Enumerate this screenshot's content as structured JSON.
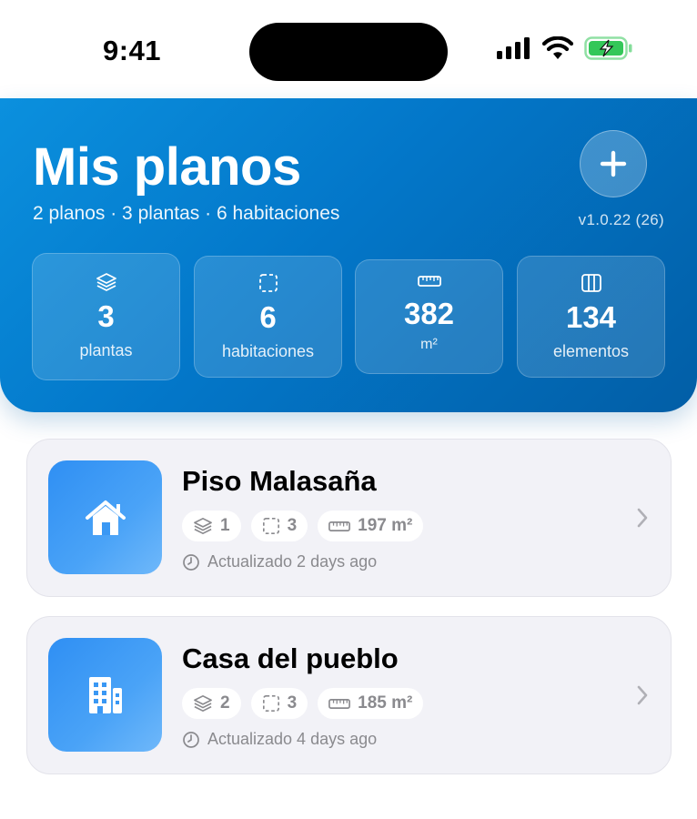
{
  "status_bar": {
    "time": "9:41"
  },
  "header": {
    "title": "Mis planos",
    "subtitle": "2 planos · 3 plantas · 6 habitaciones",
    "version": "v1.0.22 (26)"
  },
  "stats": [
    {
      "icon": "layers-icon",
      "value": "3",
      "label": "plantas"
    },
    {
      "icon": "room-outline-icon",
      "value": "6",
      "label": "habitaciones"
    },
    {
      "icon": "ruler-icon",
      "value": "382",
      "label": "m²"
    },
    {
      "icon": "columns-icon",
      "value": "134",
      "label": "elementos"
    }
  ],
  "plans": [
    {
      "name": "Piso Malasaña",
      "icon": "house-icon",
      "floors": "1",
      "rooms": "3",
      "area": "197 m²",
      "updated": "Actualizado 2 days ago"
    },
    {
      "name": "Casa del pueblo",
      "icon": "building-icon",
      "floors": "2",
      "rooms": "3",
      "area": "185 m²",
      "updated": "Actualizado 4 days ago"
    }
  ],
  "colors": {
    "header_start": "#0b90de",
    "header_end": "#025ea6",
    "card_bg": "#f2f2f7",
    "thumb_blue": "#2f8ff3",
    "battery_green": "#34c759"
  }
}
